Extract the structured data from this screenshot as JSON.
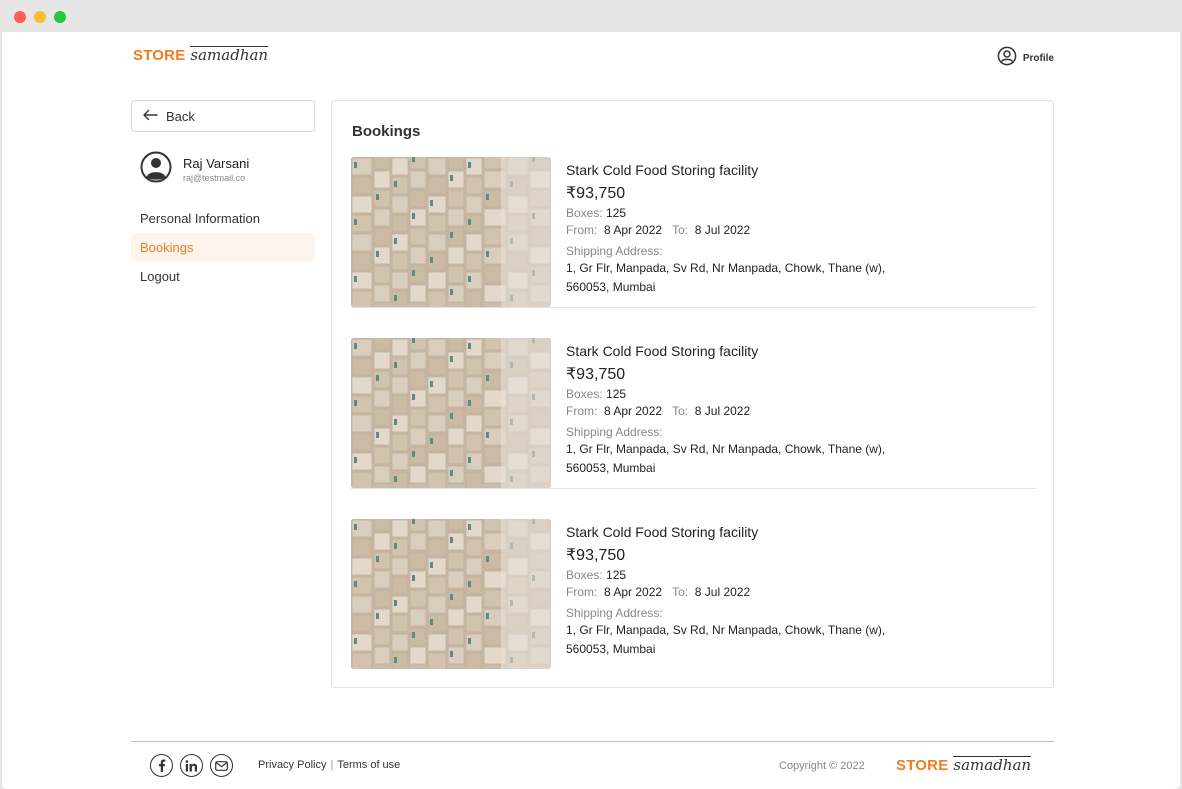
{
  "brand": {
    "store": "STORE",
    "samadhan": "samadhan",
    "accent": "#ef7d1f"
  },
  "header": {
    "profile_label": "Profile",
    "profile_icon": "user-circle-icon"
  },
  "sidebar": {
    "back_label": "Back",
    "user": {
      "name": "Raj Varsani",
      "email": "raj@testmail.co"
    },
    "nav": [
      {
        "label": "Personal Information",
        "active": false
      },
      {
        "label": "Bookings",
        "active": true
      },
      {
        "label": "Logout",
        "active": false
      }
    ]
  },
  "main": {
    "title": "Bookings",
    "bookings": [
      {
        "title": "Stark Cold Food Storing facility",
        "price": "₹93,750",
        "boxes_label": "Boxes:",
        "boxes": "125",
        "from_label": "From:",
        "from": "8 Apr 2022",
        "to_label": "To:",
        "to": "8 Jul 2022",
        "address_label": "Shipping Address:",
        "address_line1": "1, Gr Flr, Manpada, Sv Rd, Nr Manpada, Chowk, Thane (w),",
        "address_line2": "560053, Mumbai"
      },
      {
        "title": "Stark Cold Food Storing facility",
        "price": "₹93,750",
        "boxes_label": "Boxes:",
        "boxes": "125",
        "from_label": "From:",
        "from": "8 Apr 2022",
        "to_label": "To:",
        "to": "8 Jul 2022",
        "address_label": "Shipping Address:",
        "address_line1": "1, Gr Flr, Manpada, Sv Rd, Nr Manpada, Chowk, Thane (w),",
        "address_line2": "560053, Mumbai"
      },
      {
        "title": "Stark Cold Food Storing facility",
        "price": "₹93,750",
        "boxes_label": "Boxes:",
        "boxes": "125",
        "from_label": "From:",
        "from": "8 Apr 2022",
        "to_label": "To:",
        "to": "8 Jul 2022",
        "address_label": "Shipping Address:",
        "address_line1": "1, Gr Flr, Manpada, Sv Rd, Nr Manpada, Chowk, Thane (w),",
        "address_line2": "560053, Mumbai"
      }
    ]
  },
  "footer": {
    "socials": [
      "facebook-icon",
      "linkedin-icon",
      "mail-icon"
    ],
    "privacy": "Privacy Policy",
    "separator": "|",
    "terms": "Terms of use",
    "copyright": "Copyright © 2022"
  }
}
